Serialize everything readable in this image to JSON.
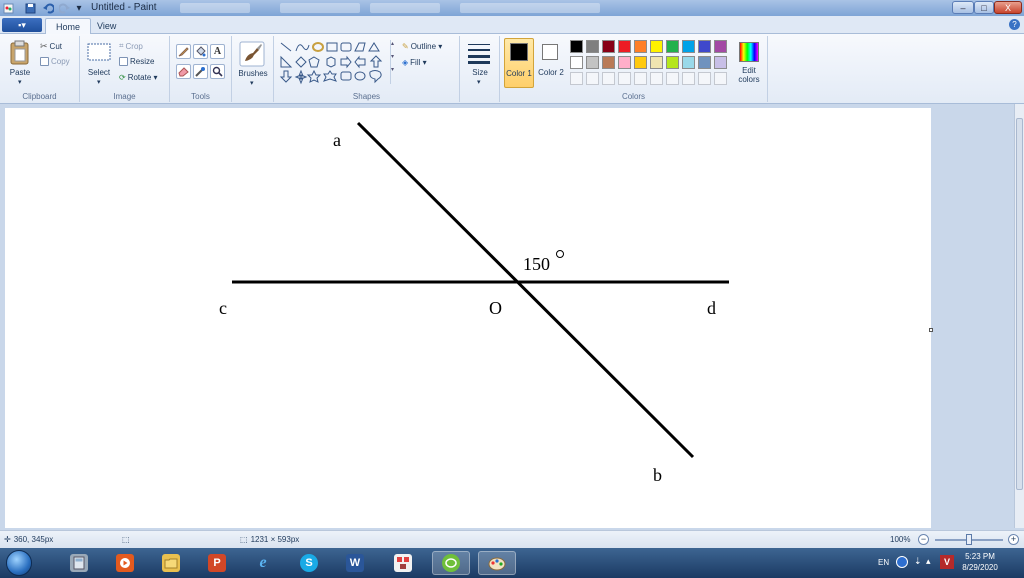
{
  "window": {
    "title": "Untitled - Paint",
    "minimize_glyph": "–",
    "maximize_glyph": "□",
    "close_glyph": "X"
  },
  "quick_access": {
    "icons": [
      "save-icon",
      "undo-icon",
      "redo-icon",
      "customize-icon"
    ]
  },
  "tabs": {
    "file_menu": "▪▾",
    "home": "Home",
    "view": "View",
    "help_glyph": "?"
  },
  "ribbon": {
    "clipboard": {
      "label": "Clipboard",
      "paste": "Paste",
      "cut": "Cut",
      "copy": "Copy"
    },
    "image": {
      "label": "Image",
      "select": "Select",
      "crop": "Crop",
      "resize": "Resize",
      "rotate": "Rotate ▾"
    },
    "tools": {
      "label": "Tools",
      "icons": [
        "pencil-icon",
        "fill-icon",
        "text-icon",
        "eraser-icon",
        "color-picker-icon",
        "magnifier-icon"
      ],
      "text_glyph": "A"
    },
    "brushes": {
      "label": "Brushes"
    },
    "shapes": {
      "label": "Shapes",
      "outline": "Outline ▾",
      "fill": "Fill ▾"
    },
    "size": {
      "label": "Size"
    },
    "colors": {
      "label": "Colors",
      "color1_label": "Color 1",
      "color2_label": "Color 2",
      "color1": "#000000",
      "color2": "#ffffff",
      "edit_colors": "Edit colors",
      "palette_row1": [
        "#000000",
        "#7f7f7f",
        "#880015",
        "#ed1c24",
        "#ff7f27",
        "#fff200",
        "#22b14c",
        "#00a2e8",
        "#3f48cc",
        "#a349a4"
      ],
      "palette_row2": [
        "#ffffff",
        "#c3c3c3",
        "#b97a57",
        "#ffaec9",
        "#ffc90e",
        "#efe4b0",
        "#b5e61d",
        "#99d9ea",
        "#7092be",
        "#c8bfe7"
      ]
    }
  },
  "canvas": {
    "labels": {
      "a": "a",
      "b": "b",
      "c": "c",
      "d": "d",
      "o": "O",
      "angle": "150"
    }
  },
  "statusbar": {
    "cursor_pos": "360, 345px",
    "selection_size": "",
    "image_size": "1231 × 593px",
    "zoom": "100%",
    "zoom_out": "−",
    "zoom_in": "+"
  },
  "taskbar": {
    "apps": [
      "calculator-app",
      "media-app",
      "explorer-app",
      "powerpoint-app",
      "ie-app",
      "skype-app",
      "word-app",
      "network-app",
      "geogebra-app",
      "paint-app"
    ],
    "app_glyphs": {
      "powerpoint": "P",
      "skype": "S",
      "word": "W"
    },
    "lang": "EN",
    "time": "5:23 PM",
    "date": "8/29/2020"
  }
}
